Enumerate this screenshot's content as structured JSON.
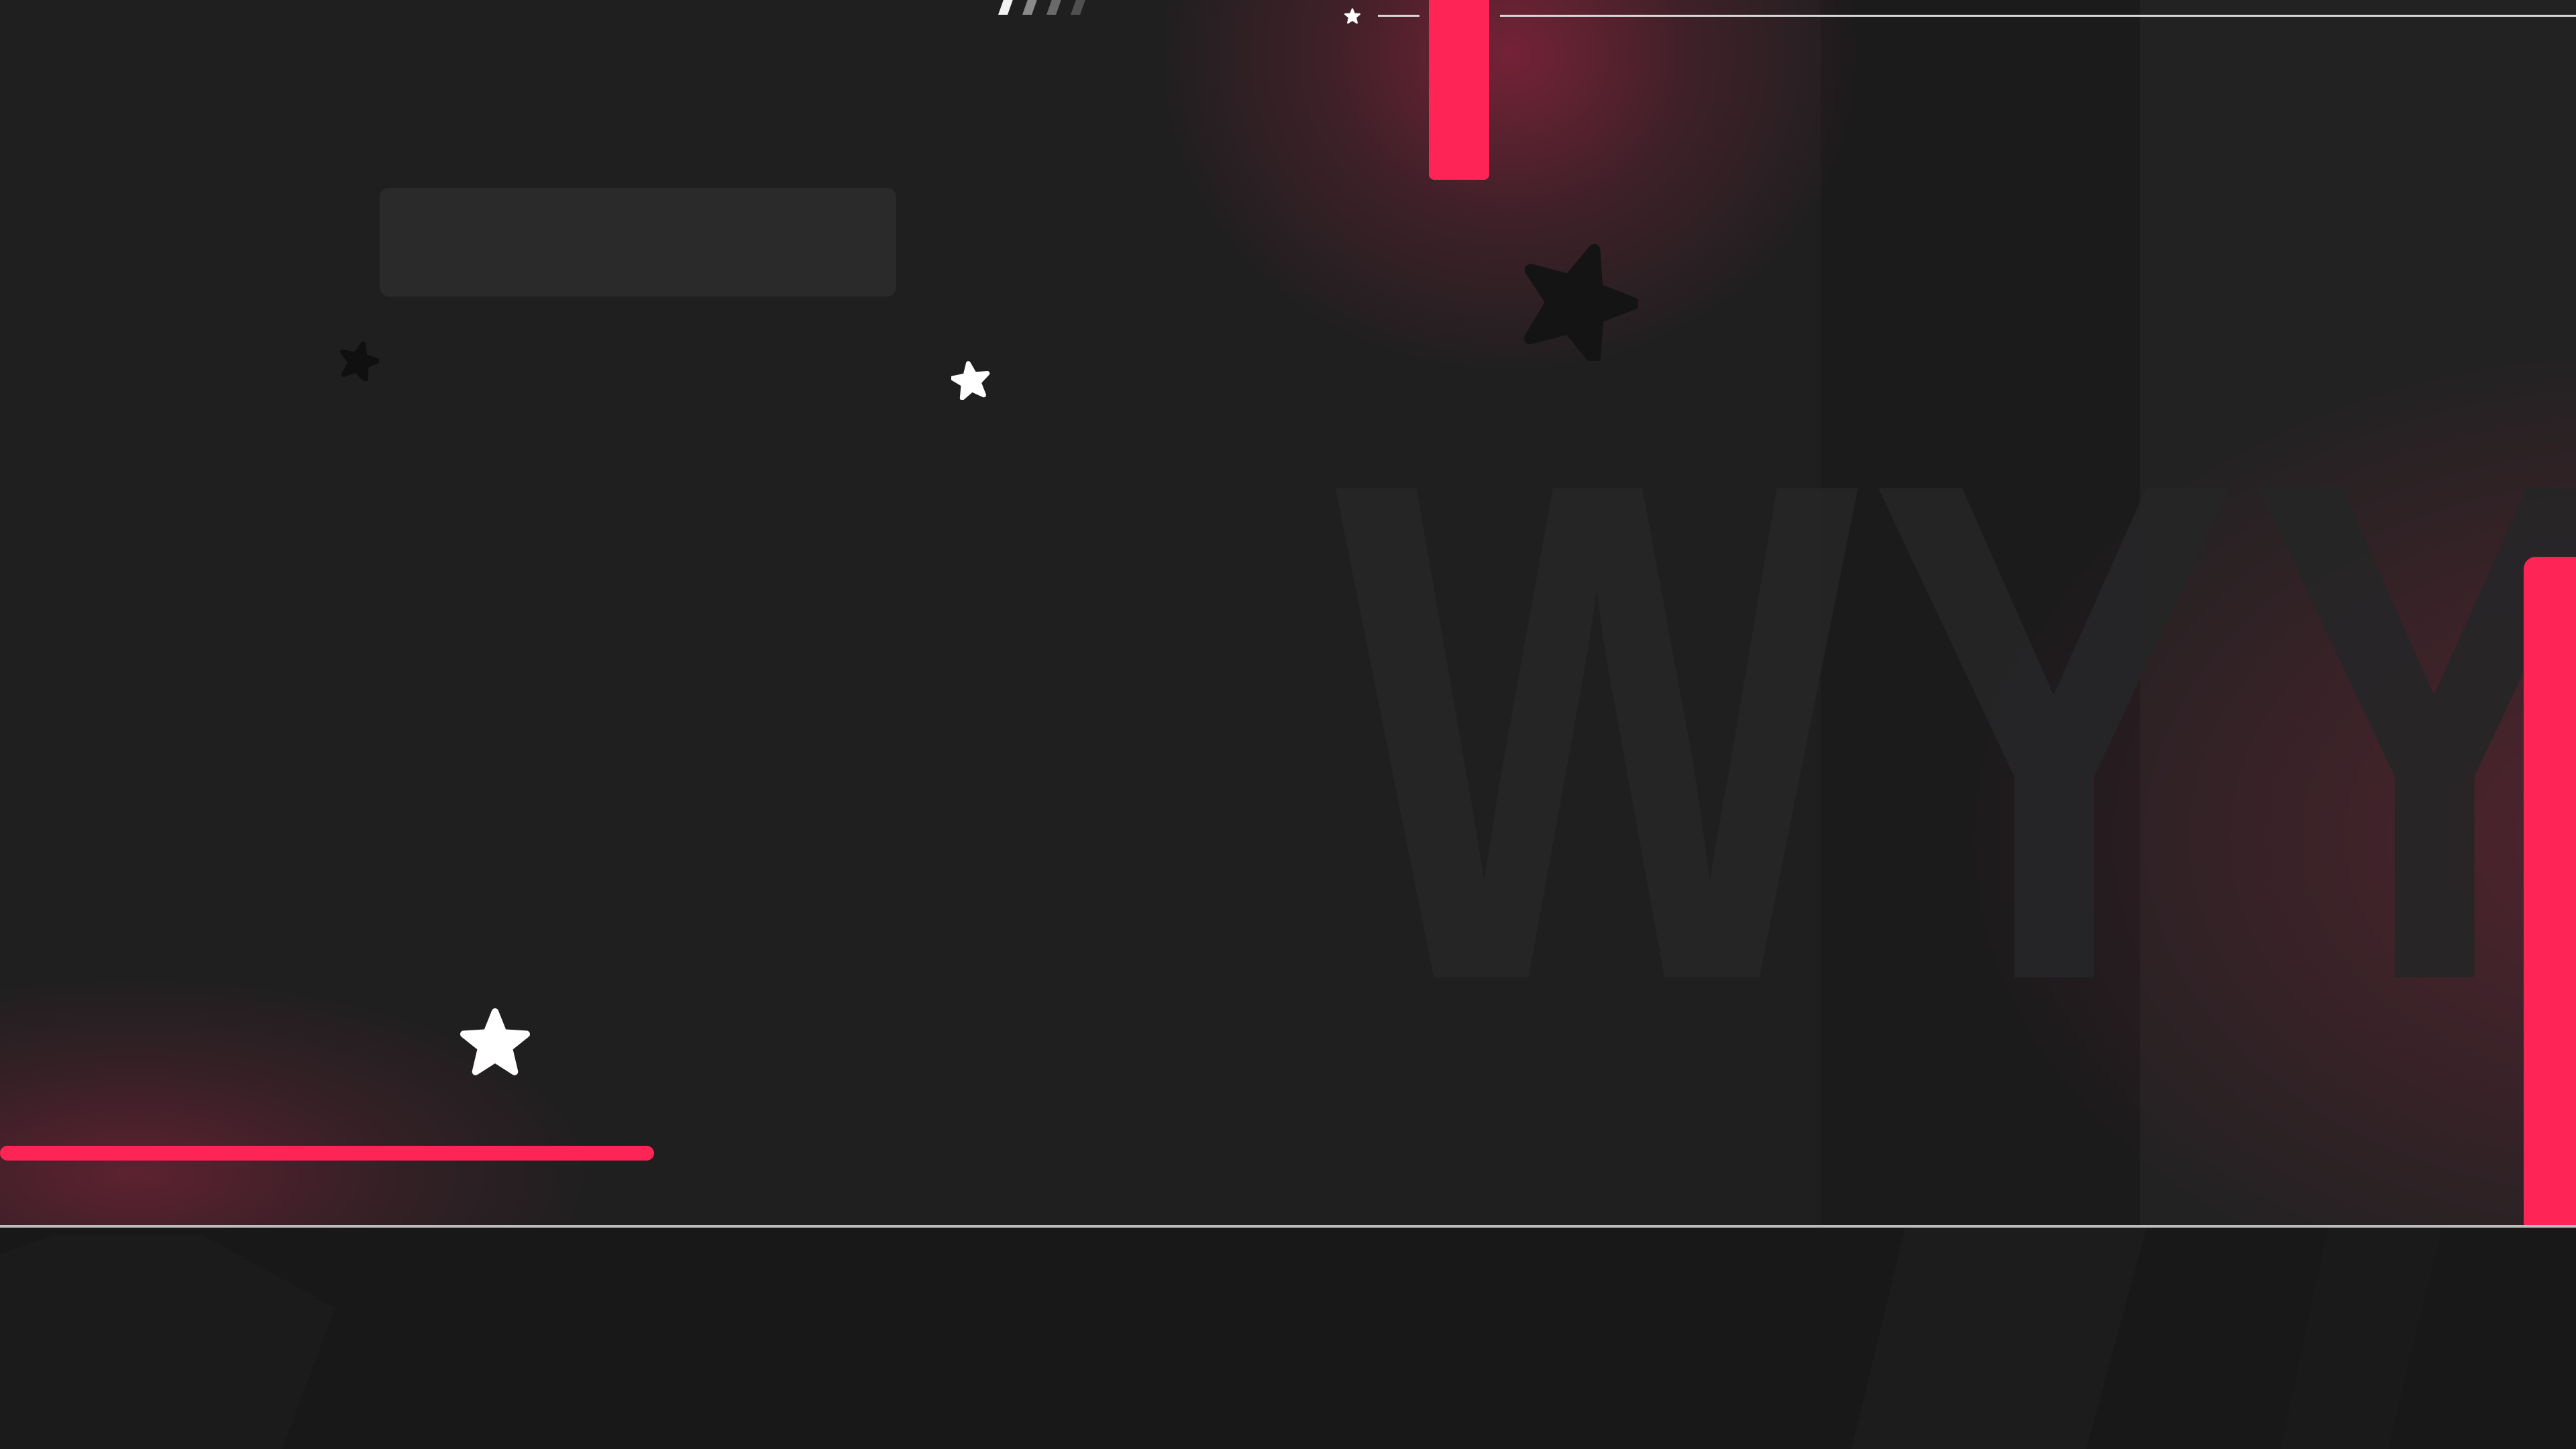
{
  "background": {
    "watermark_text": "WYYNE",
    "colors": {
      "base": "#1f1f20",
      "panel": "#1b1b1c",
      "bottom_strip": "#181818",
      "accent": "#ff2456",
      "input_box": "#2a2a2b",
      "divider": "#bdbdbd"
    }
  },
  "header": {
    "logo_icon": "slashes-logo-icon",
    "small_star_icon": "star-icon"
  },
  "search": {
    "placeholder": "",
    "value": ""
  },
  "progress": {
    "percent": 25
  },
  "icons": [
    "star-icon",
    "star-icon",
    "star-icon",
    "star-icon",
    "star-icon",
    "slashes-logo-icon"
  ]
}
